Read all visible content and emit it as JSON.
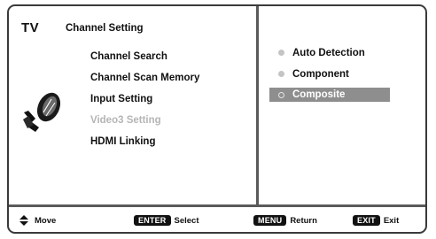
{
  "header": {
    "tv_label": "TV",
    "menu_title": "Channel Setting"
  },
  "menu": {
    "items": [
      {
        "label": "Channel Search",
        "enabled": true
      },
      {
        "label": "Channel Scan Memory",
        "enabled": true
      },
      {
        "label": "Input Setting",
        "enabled": true
      },
      {
        "label": "Video3 Setting",
        "enabled": false
      },
      {
        "label": "HDMI Linking",
        "enabled": true
      }
    ]
  },
  "options": {
    "items": [
      {
        "label": "Auto Detection",
        "selected": false
      },
      {
        "label": "Component",
        "selected": false
      },
      {
        "label": "Composite",
        "selected": true
      }
    ]
  },
  "footer": {
    "move_label": "Move",
    "enter_key": "ENTER",
    "select_label": "Select",
    "menu_key": "MENU",
    "return_label": "Return",
    "exit_key": "EXIT",
    "exit_label": "Exit"
  },
  "colors": {
    "border": "#3a3a3a",
    "highlight": "#8e8e8e",
    "disabled_text": "#b5b5b5",
    "key_bg": "#111111"
  },
  "icons": {
    "menu_icon": "satellite-dish-icon",
    "move_icon": "up-down-arrows-icon"
  }
}
